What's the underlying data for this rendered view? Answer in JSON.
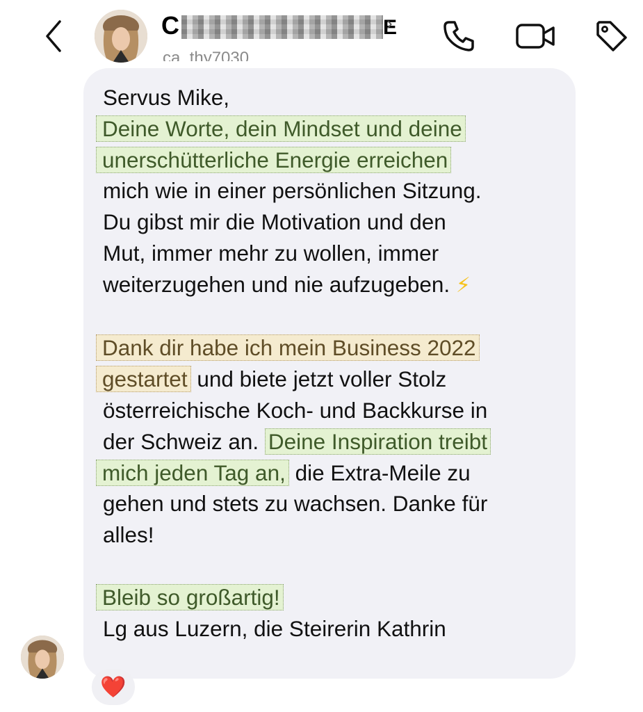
{
  "header": {
    "contact_name_prefix": "C",
    "contact_name_suffix": "E",
    "contact_handle": "ca_thy7030",
    "icons": [
      "back-chevron-icon",
      "phone-icon",
      "video-icon",
      "tag-icon"
    ]
  },
  "message": {
    "greeting": "Servus Mike,",
    "p1_hl_line1": "Deine Worte, dein Mindset und deine",
    "p1_hl_line2": "unerschütterliche Energie erreichen",
    "p1_line3": "mich wie in einer persönlichen Sitzung.",
    "p1_line4": "Du gibst mir die Motivation und den",
    "p1_line5": "Mut, immer mehr zu wollen, immer",
    "p1_line6": "weiterzugehen und nie aufzugeben.",
    "p1_emoji": "⚡",
    "p2_hl_line1": "Dank dir habe ich mein Business 2022",
    "p2_hl_line2": "gestartet",
    "p2_line2_rest": " und biete jetzt voller Stolz",
    "p2_line3": "österreichische Koch- und Backkurse in",
    "p2_line4_start": "der Schweiz an. ",
    "p2_hl_line4": "Deine Inspiration treibt",
    "p2_hl_line5": "mich jeden Tag an,",
    "p2_line5_rest": " die Extra-Meile zu",
    "p2_line6": "gehen und stets zu wachsen. Danke für",
    "p2_line7": "alles!",
    "p3_hl": "Bleib so großartig!",
    "signoff": "Lg aus Luzern, die Steirerin Kathrin"
  },
  "reaction": {
    "emoji": "❤️"
  },
  "colors": {
    "bubble": "#f1f1f6",
    "highlight_green": "#e4f2d2",
    "highlight_yellow": "#f5ebcf"
  }
}
